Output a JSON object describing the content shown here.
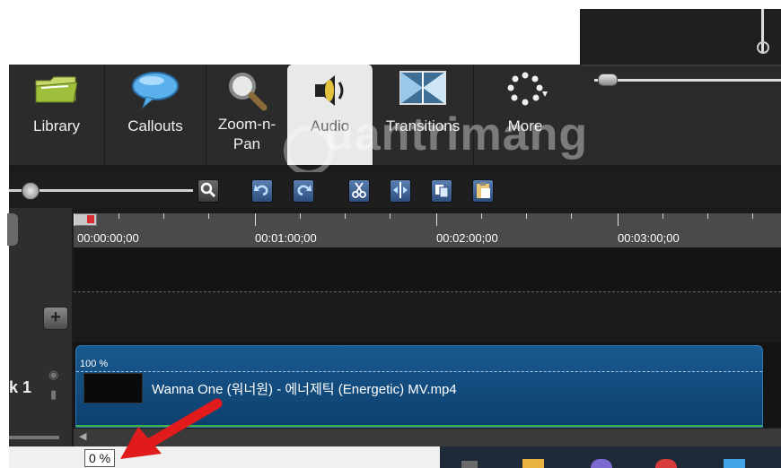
{
  "tabs": [
    {
      "label": "Library",
      "icon": "folder-icon"
    },
    {
      "label": "Callouts",
      "icon": "speech-bubble-icon"
    },
    {
      "label": "Zoom-n-\nPan",
      "icon": "magnifier-icon"
    },
    {
      "label": "Audio",
      "icon": "speaker-icon"
    },
    {
      "label": "Transitions",
      "icon": "transitions-icon"
    },
    {
      "label": "More",
      "icon": "spinner-icon"
    }
  ],
  "active_tab": "Audio",
  "ruler": {
    "times": [
      "00:00:00;00",
      "00:01:00;00",
      "00:02:00;00",
      "00:03:00;00"
    ]
  },
  "track": {
    "label": "k 1",
    "clip_volume": "100 %",
    "clip_name": "Wanna One (워너원) - 에너제틱 (Energetic) MV.mp4"
  },
  "tooltip": "0 %",
  "watermark": "uantrimang",
  "colors": {
    "clip": "#0c3f6e",
    "accent": "#e11b1b"
  }
}
